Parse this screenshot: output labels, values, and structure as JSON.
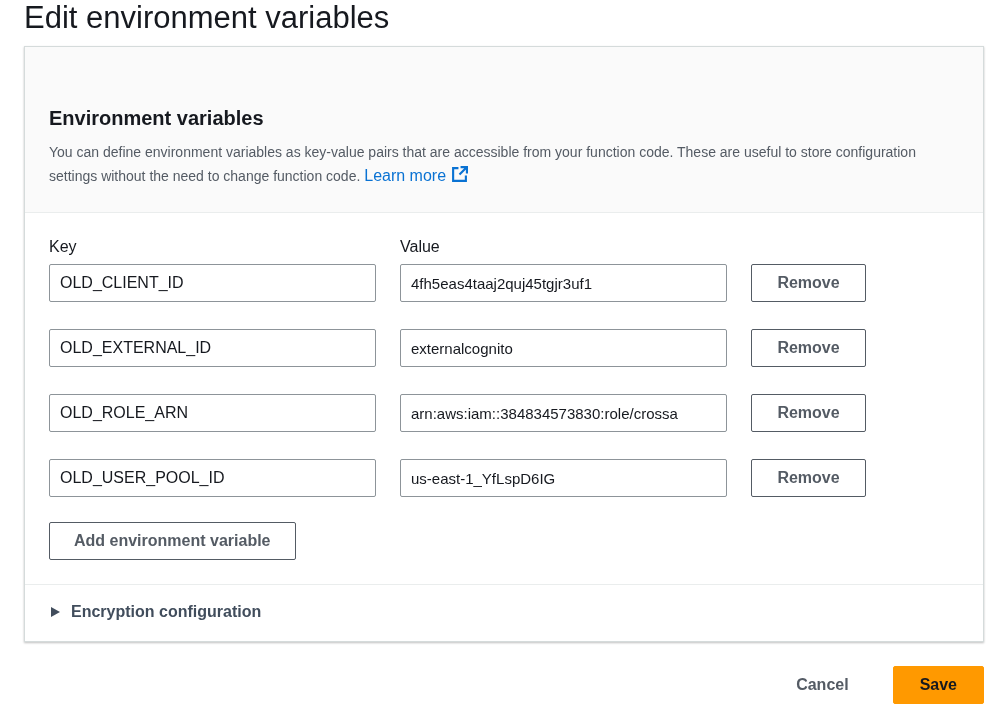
{
  "page_title": "Edit environment variables",
  "panel": {
    "title": "Environment variables",
    "description": "You can define environment variables as key-value pairs that are accessible from your function code. These are useful to store configuration settings without the need to change function code.",
    "learn_more": "Learn more",
    "columns": [
      "Key",
      "Value"
    ],
    "variables": [
      {
        "key": "OLD_CLIENT_ID",
        "value": "4fh5eas4taaj2quj45tgjr3uf1",
        "remove": "Remove"
      },
      {
        "key": "OLD_EXTERNAL_ID",
        "value": "externalcognito",
        "remove": "Remove"
      },
      {
        "key": "OLD_ROLE_ARN",
        "value": "arn:aws:iam::384834573830:role/crossa",
        "remove": "Remove"
      },
      {
        "key": "OLD_USER_POOL_ID",
        "value": "us-east-1_YfLspD6IG",
        "remove": "Remove"
      }
    ],
    "add_button": "Add environment variable",
    "encryption": {
      "label": "Encryption configuration",
      "expanded": false
    }
  },
  "buttons": {
    "cancel": "Cancel",
    "save": "Save"
  }
}
